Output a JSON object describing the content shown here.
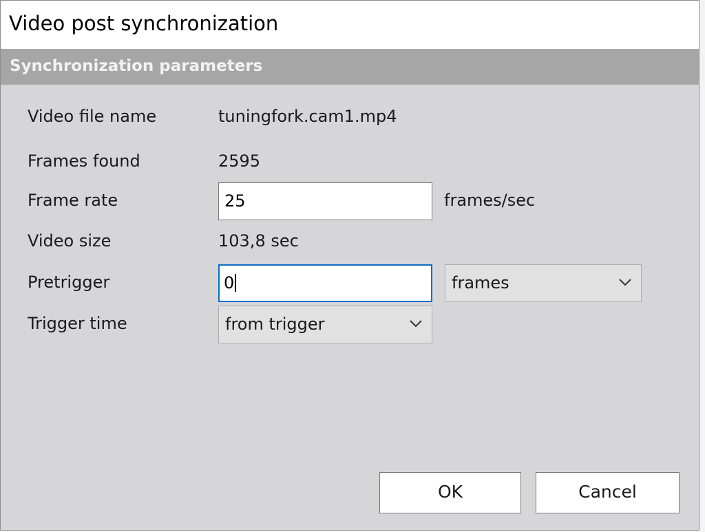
{
  "dialog": {
    "title": "Video post synchronization",
    "section_title": "Synchronization parameters"
  },
  "fields": {
    "video_file_name": {
      "label": "Video file name",
      "value": "tuningfork.cam1.mp4"
    },
    "frames_found": {
      "label": "Frames found",
      "value": "2595"
    },
    "frame_rate": {
      "label": "Frame rate",
      "value": "25",
      "unit": "frames/sec"
    },
    "video_size": {
      "label": "Video size",
      "value": "103,8 sec"
    },
    "pretrigger": {
      "label": "Pretrigger",
      "value": "0",
      "unit_selected": "frames"
    },
    "trigger_time": {
      "label": "Trigger time",
      "selected": "from trigger"
    }
  },
  "buttons": {
    "ok": "OK",
    "cancel": "Cancel"
  },
  "colors": {
    "dialog_bg": "#d6d5d8",
    "section_header_bg": "#a6a6a6",
    "focus_border": "#0b6fc4"
  },
  "icons": {
    "dropdown": "chevron-down-icon"
  }
}
